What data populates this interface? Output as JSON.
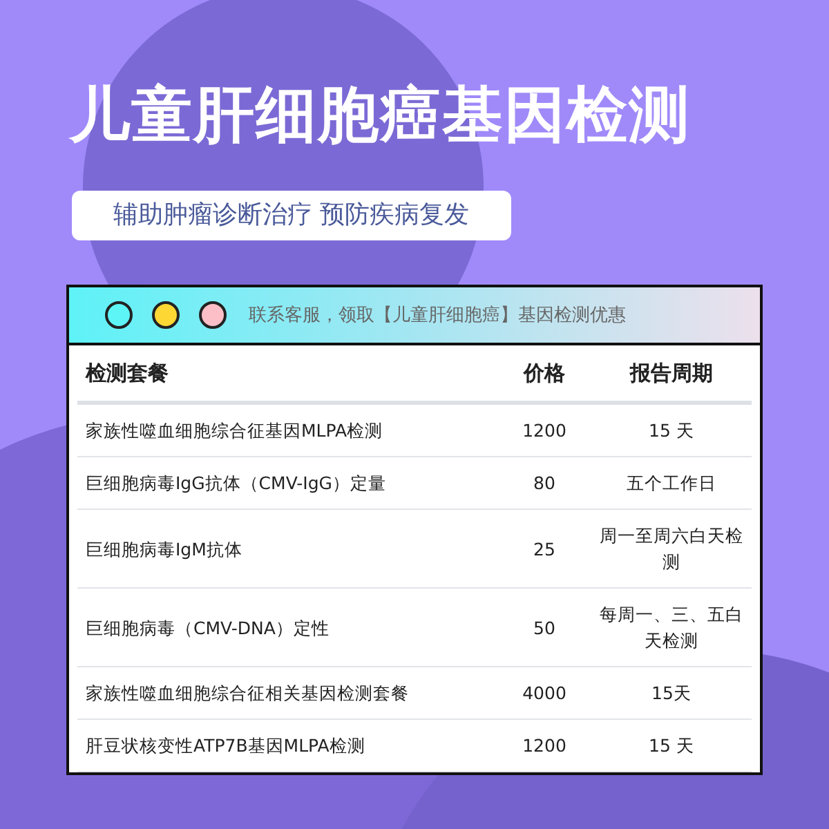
{
  "title": "儿童肝细胞癌基因检测",
  "subtitle": "辅助肿瘤诊断治疗 预防疾病复发",
  "banner": {
    "dots": [
      {
        "color": "#5ef5f7"
      },
      {
        "color": "#fdd835"
      },
      {
        "color": "#fdbfc7"
      }
    ],
    "text": "联系客服，领取【儿童肝细胞癌】基因检测优惠"
  },
  "table": {
    "columns": [
      "检测套餐",
      "价格",
      "报告周期"
    ],
    "rows": [
      [
        "家族性噬血细胞综合征基因MLPA检测",
        "1200",
        "15 天"
      ],
      [
        "巨细胞病毒IgG抗体（CMV-IgG）定量",
        "80",
        "五个工作日"
      ],
      [
        "巨细胞病毒IgM抗体",
        "25",
        "周一至周六白天检测"
      ],
      [
        "巨细胞病毒（CMV-DNA）定性",
        "50",
        "每周一、三、五白天检测"
      ],
      [
        "家族性噬血细胞综合征相关基因检测套餐",
        "4000",
        "15天"
      ],
      [
        "肝豆状核变性ATP7B基因MLPA检测",
        "1200",
        "15 天"
      ]
    ]
  }
}
